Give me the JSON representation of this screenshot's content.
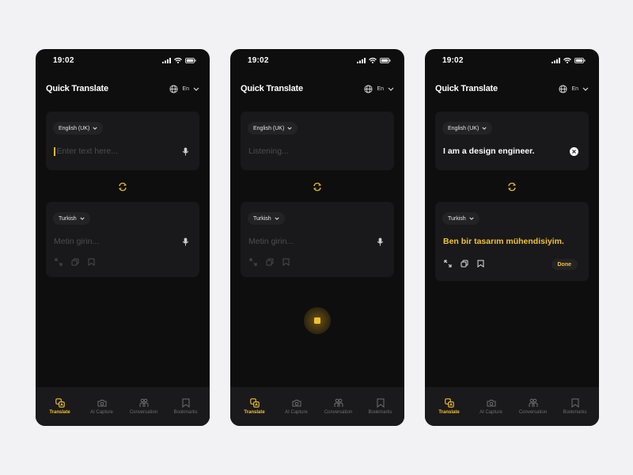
{
  "colors": {
    "accent": "#f2c12e",
    "background": "#0e0e0f",
    "card": "#19191b",
    "page": "#f2f1f3"
  },
  "screens": [
    {
      "status": {
        "time": "19:02"
      },
      "header": {
        "title": "Quick Translate",
        "lang": "En"
      },
      "source": {
        "language": "English (UK)",
        "placeholder": "Enter text here..."
      },
      "target": {
        "language": "Turkish",
        "placeholder": "Metin girin..."
      },
      "tabs": [
        {
          "label": "Translate",
          "icon": "translate-icon"
        },
        {
          "label": "AI Capture",
          "icon": "camera-icon"
        },
        {
          "label": "Conversation",
          "icon": "conversation-icon"
        },
        {
          "label": "Bookmarks",
          "icon": "bookmark-icon"
        }
      ]
    },
    {
      "status": {
        "time": "19:02"
      },
      "header": {
        "title": "Quick Translate",
        "lang": "En"
      },
      "source": {
        "language": "English (UK)",
        "placeholder": "Listening..."
      },
      "target": {
        "language": "Turkish",
        "placeholder": "Metin girin..."
      },
      "tabs": [
        {
          "label": "Translate",
          "icon": "translate-icon"
        },
        {
          "label": "AI Capture",
          "icon": "camera-icon"
        },
        {
          "label": "Conversation",
          "icon": "conversation-icon"
        },
        {
          "label": "Bookmarks",
          "icon": "bookmark-icon"
        }
      ]
    },
    {
      "status": {
        "time": "19:02"
      },
      "header": {
        "title": "Quick Translate",
        "lang": "En"
      },
      "source": {
        "language": "English (UK)",
        "text": "I am a design engineer."
      },
      "target": {
        "language": "Turkish",
        "text": "Ben bir tasarım mühendisiyim.",
        "done_label": "Done"
      },
      "tabs": [
        {
          "label": "Translate",
          "icon": "translate-icon"
        },
        {
          "label": "AI Capture",
          "icon": "camera-icon"
        },
        {
          "label": "Conversation",
          "icon": "conversation-icon"
        },
        {
          "label": "Bookmarks",
          "icon": "bookmark-icon"
        }
      ]
    }
  ]
}
